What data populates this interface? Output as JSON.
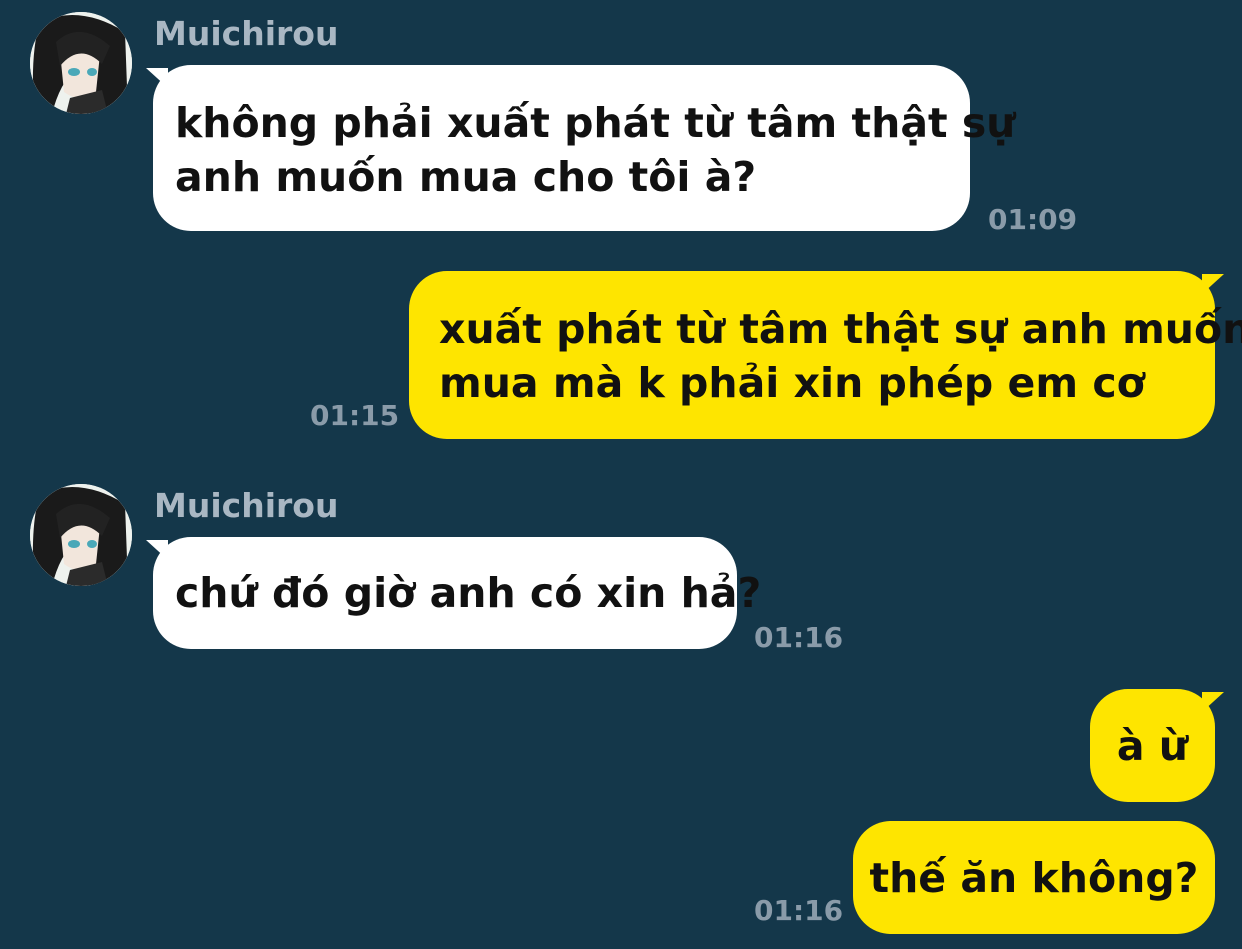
{
  "chat": {
    "messages": [
      {
        "direction": "incoming",
        "sender": "Muichirou",
        "lines": [
          "không phải xuất phát từ tâm thật sự",
          "anh muốn mua cho tôi à?"
        ],
        "time": "01:09"
      },
      {
        "direction": "outgoing",
        "lines": [
          "xuất phát từ tâm thật sự anh muốn",
          "mua mà k phải xin phép em cơ"
        ],
        "time": "01:15"
      },
      {
        "direction": "incoming",
        "sender": "Muichirou",
        "lines": [
          "chứ đó giờ anh có xin hả?"
        ],
        "time": "01:16"
      },
      {
        "direction": "outgoing",
        "lines": [
          "à ừ"
        ]
      },
      {
        "direction": "outgoing",
        "lines": [
          "thế ăn không?"
        ],
        "time": "01:16"
      }
    ]
  },
  "colors": {
    "background": "#14374a",
    "incoming_bubble": "#ffffff",
    "outgoing_bubble": "#fee500",
    "meta_text": "#8a9ba9"
  },
  "icons": {
    "avatar": "avatar-icon"
  }
}
